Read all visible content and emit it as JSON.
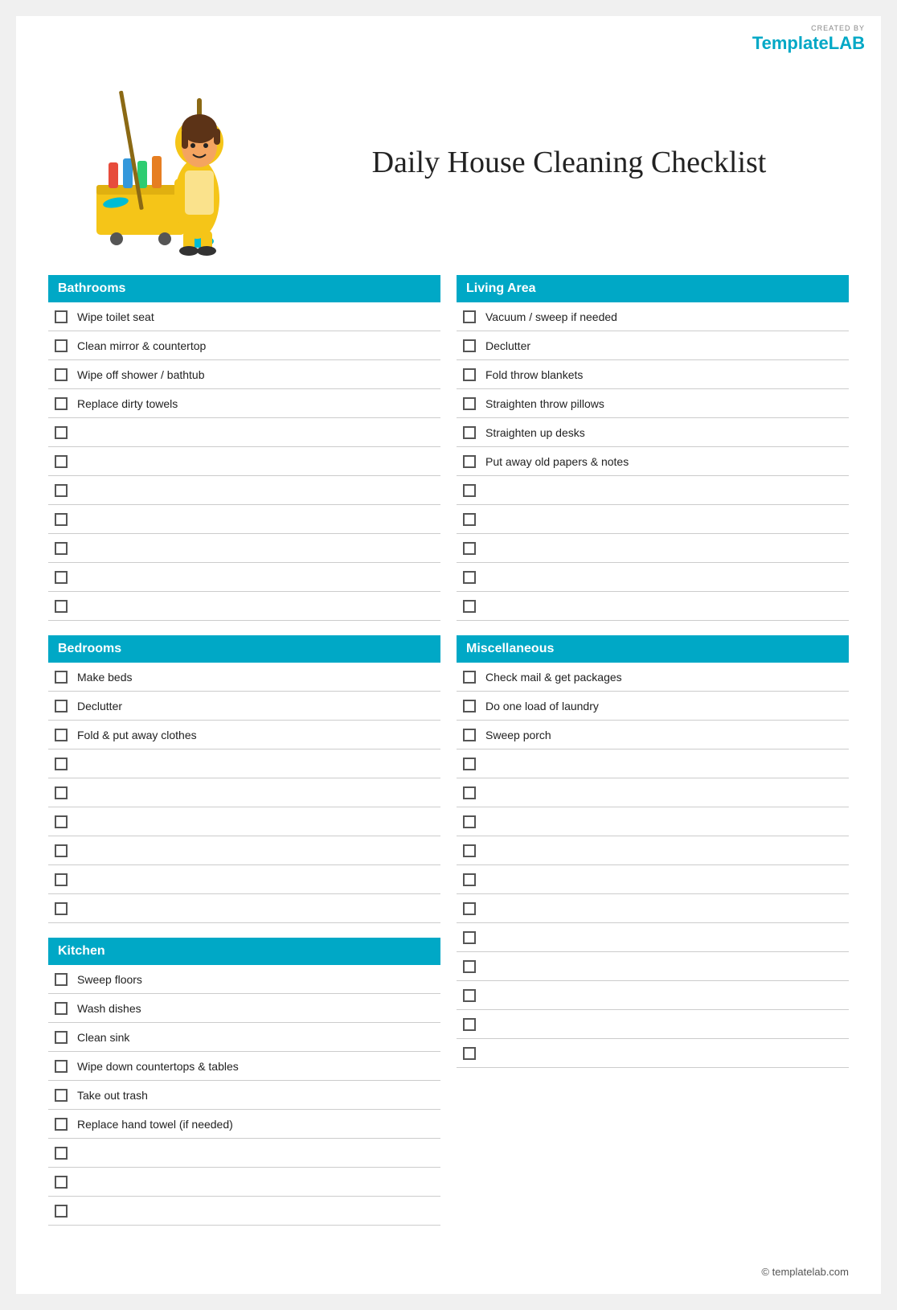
{
  "brand": {
    "created_by": "CREATED BY",
    "name_part1": "Template",
    "name_part2": "LAB"
  },
  "title": "Daily House Cleaning Checklist",
  "sections": {
    "bathrooms": {
      "label": "Bathrooms",
      "items": [
        "Wipe toilet seat",
        "Clean mirror & countertop",
        "Wipe off shower / bathtub",
        "Replace dirty towels",
        "",
        "",
        "",
        "",
        "",
        "",
        ""
      ]
    },
    "living_area": {
      "label": "Living Area",
      "items": [
        "Vacuum / sweep if needed",
        "Declutter",
        "Fold throw blankets",
        "Straighten throw pillows",
        "Straighten up desks",
        "Put away old papers & notes",
        "",
        "",
        "",
        "",
        ""
      ]
    },
    "bedrooms": {
      "label": "Bedrooms",
      "items": [
        "Make beds",
        "Declutter",
        "Fold & put away clothes",
        "",
        "",
        "",
        "",
        "",
        ""
      ]
    },
    "miscellaneous": {
      "label": "Miscellaneous",
      "items": [
        "Check mail & get packages",
        "Do one load of laundry",
        "Sweep porch",
        "",
        "",
        "",
        "",
        "",
        "",
        "",
        "",
        "",
        "",
        ""
      ]
    },
    "kitchen": {
      "label": "Kitchen",
      "items": [
        "Sweep floors",
        "Wash dishes",
        "Clean sink",
        "Wipe down countertops & tables",
        "Take out trash",
        "Replace hand towel (if needed)",
        "",
        "",
        ""
      ]
    }
  },
  "footer": {
    "copyright": "© templatelab.com"
  }
}
